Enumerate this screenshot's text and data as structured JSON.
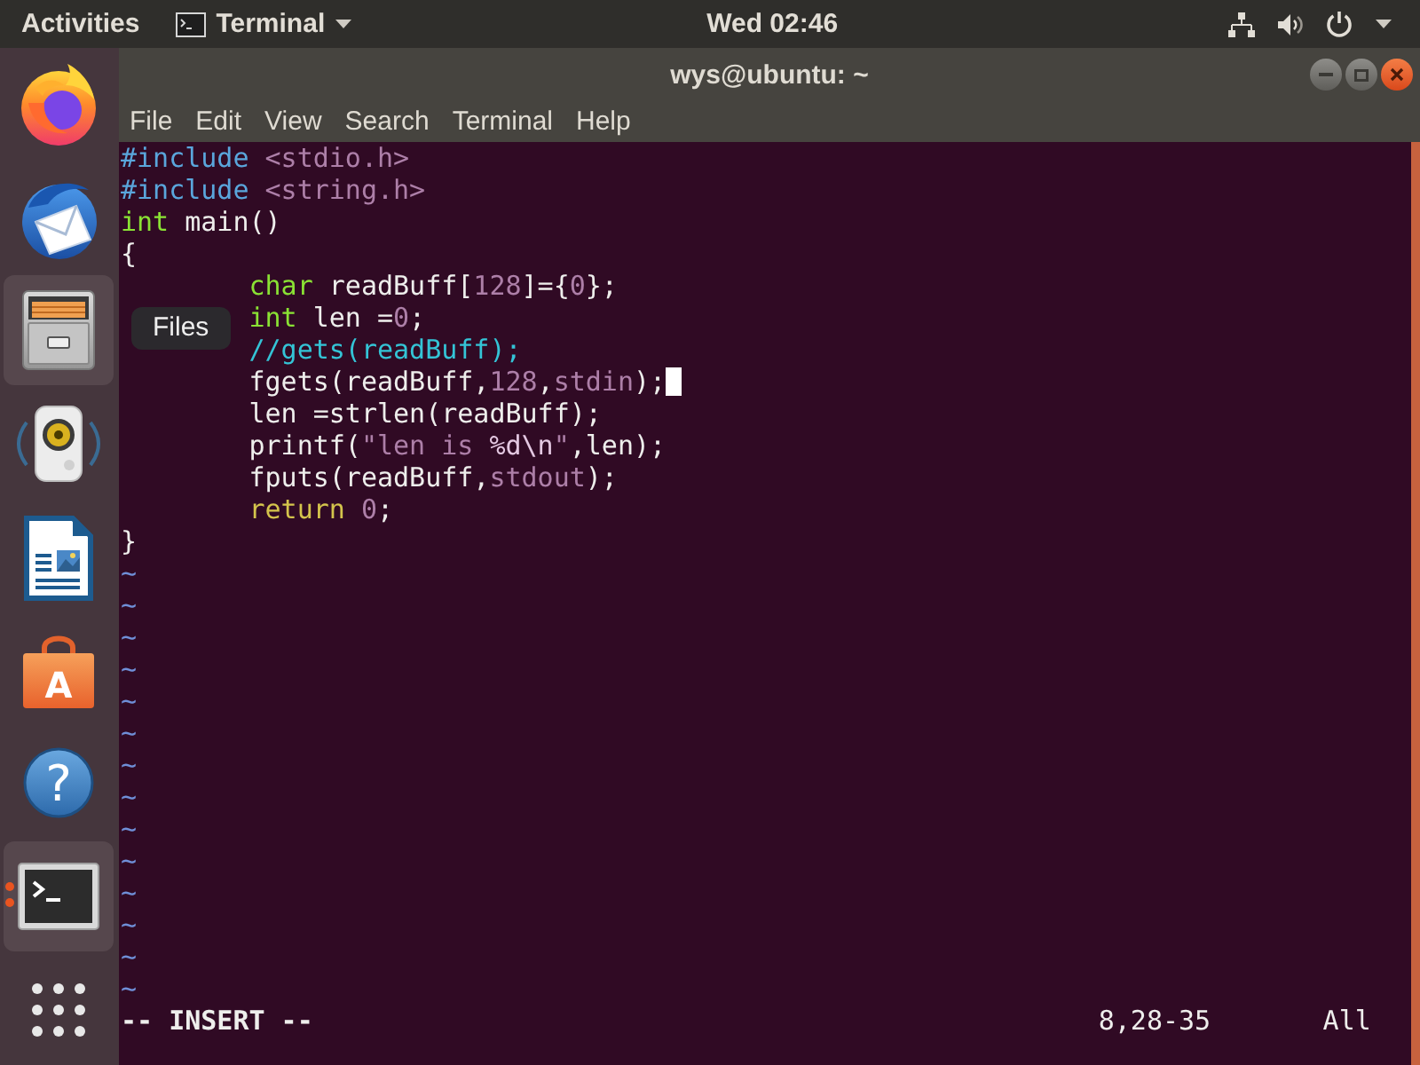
{
  "top_bar": {
    "activities": "Activities",
    "app_menu": "Terminal",
    "clock": "Wed 02:46"
  },
  "dock": {
    "items": [
      {
        "kind": "browser",
        "highlighted": false,
        "running": false
      },
      {
        "kind": "mail",
        "highlighted": false,
        "running": false
      },
      {
        "kind": "files",
        "highlighted": true,
        "running": false,
        "tooltip": "Files"
      },
      {
        "kind": "music",
        "highlighted": false,
        "running": false
      },
      {
        "kind": "writer",
        "highlighted": false,
        "running": false
      },
      {
        "kind": "software",
        "highlighted": false,
        "running": false,
        "glyph": "A"
      },
      {
        "kind": "help",
        "highlighted": false,
        "running": false,
        "glyph": "?"
      },
      {
        "kind": "terminal",
        "highlighted": true,
        "running": true
      },
      {
        "kind": "apps",
        "highlighted": false,
        "running": false
      }
    ]
  },
  "window": {
    "title": "wys@ubuntu: ~"
  },
  "menu_bar": [
    "File",
    "Edit",
    "View",
    "Search",
    "Terminal",
    "Help"
  ],
  "editor": {
    "lines": [
      {
        "indented": false,
        "cursor": false,
        "tokens": [
          {
            "kind": "preproc",
            "text": "#include"
          },
          {
            "kind": "string",
            "text": " <stdio.h>"
          }
        ]
      },
      {
        "indented": false,
        "cursor": false,
        "tokens": [
          {
            "kind": "preproc",
            "text": "#include"
          },
          {
            "kind": "string",
            "text": " <string.h>"
          }
        ]
      },
      {
        "indented": false,
        "cursor": false,
        "tokens": [
          {
            "kind": "type",
            "text": "int"
          },
          {
            "kind": "plain",
            "text": " main()"
          }
        ]
      },
      {
        "indented": false,
        "cursor": false,
        "tokens": [
          {
            "kind": "plain",
            "text": "{"
          }
        ]
      },
      {
        "indented": true,
        "cursor": false,
        "tokens": [
          {
            "kind": "type",
            "text": "char"
          },
          {
            "kind": "plain",
            "text": " readBuff["
          },
          {
            "kind": "number",
            "text": "128"
          },
          {
            "kind": "plain",
            "text": "]={"
          },
          {
            "kind": "number",
            "text": "0"
          },
          {
            "kind": "plain",
            "text": "};"
          }
        ]
      },
      {
        "indented": true,
        "cursor": false,
        "tokens": [
          {
            "kind": "type",
            "text": "int"
          },
          {
            "kind": "plain",
            "text": " len ="
          },
          {
            "kind": "number",
            "text": "0"
          },
          {
            "kind": "plain",
            "text": ";"
          }
        ]
      },
      {
        "indented": true,
        "cursor": false,
        "tokens": [
          {
            "kind": "comment",
            "text": "//gets(readBuff);"
          }
        ]
      },
      {
        "indented": true,
        "cursor": true,
        "tokens": [
          {
            "kind": "plain",
            "text": "fgets(readBuff,"
          },
          {
            "kind": "number",
            "text": "128"
          },
          {
            "kind": "plain",
            "text": ","
          },
          {
            "kind": "constant",
            "text": "stdin"
          },
          {
            "kind": "plain",
            "text": ");"
          }
        ]
      },
      {
        "indented": true,
        "cursor": false,
        "tokens": [
          {
            "kind": "plain",
            "text": "len =strlen(readBuff);"
          }
        ]
      },
      {
        "indented": true,
        "cursor": false,
        "tokens": [
          {
            "kind": "plain",
            "text": "printf("
          },
          {
            "kind": "string",
            "text": "\"len is "
          },
          {
            "kind": "special",
            "text": "%d\\n"
          },
          {
            "kind": "string",
            "text": "\""
          },
          {
            "kind": "plain",
            "text": ",len);"
          }
        ]
      },
      {
        "indented": true,
        "cursor": false,
        "tokens": [
          {
            "kind": "plain",
            "text": "fputs(readBuff,"
          },
          {
            "kind": "constant",
            "text": "stdout"
          },
          {
            "kind": "plain",
            "text": ");"
          }
        ]
      },
      {
        "indented": true,
        "cursor": false,
        "tokens": [
          {
            "kind": "statement",
            "text": "return"
          },
          {
            "kind": "number",
            "text": " 0"
          },
          {
            "kind": "plain",
            "text": ";"
          }
        ]
      },
      {
        "indented": false,
        "cursor": false,
        "tokens": [
          {
            "kind": "plain",
            "text": "}"
          }
        ]
      }
    ],
    "empty_lines": [
      "~",
      "~",
      "~",
      "~",
      "~",
      "~",
      "~",
      "~",
      "~",
      "~",
      "~",
      "~",
      "~",
      "~"
    ],
    "status": {
      "mode": "-- INSERT --",
      "position": "8,28-35",
      "scroll": "All"
    }
  }
}
